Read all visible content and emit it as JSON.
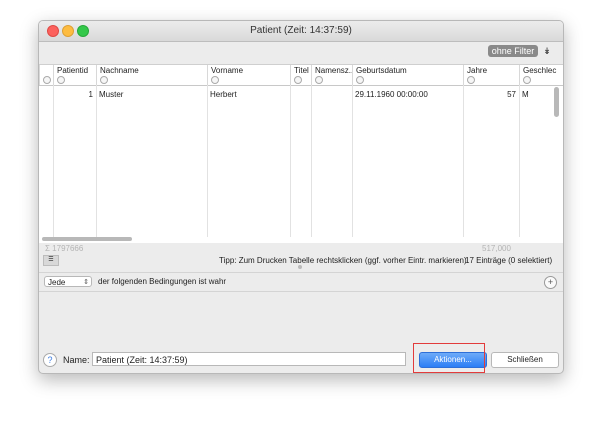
{
  "window": {
    "title": "Patient  (Zeit: 14:37:59)"
  },
  "filter": {
    "label": "ohne Filter",
    "arrow": "↡"
  },
  "table": {
    "columns": [
      "Patientid",
      "Nachname",
      "Vorname",
      "Titel",
      "Namensz...",
      "Geburtsdatum",
      "Jahre",
      "Geschlec"
    ],
    "rows": [
      [
        "1",
        "Muster",
        "Herbert",
        "",
        "",
        "29.11.1960 00:00:00",
        "57",
        "M"
      ]
    ]
  },
  "summary": {
    "left": "Σ 1797666",
    "right": "517,000"
  },
  "tip": "Tipp: Zum Drucken Tabelle rechtsklicken (ggf. vorher Eintr. markieren)",
  "count": "17 Einträge (0 selektiert)",
  "conditions": {
    "mode": "Jede",
    "text": "der folgenden Bedingungen ist wahr",
    "add": "+"
  },
  "bottom": {
    "help": "?",
    "name_label": "Name:",
    "name_value": "Patient  (Zeit: 14:37:59)",
    "actions": "Aktionen...",
    "close": "Schließen"
  }
}
